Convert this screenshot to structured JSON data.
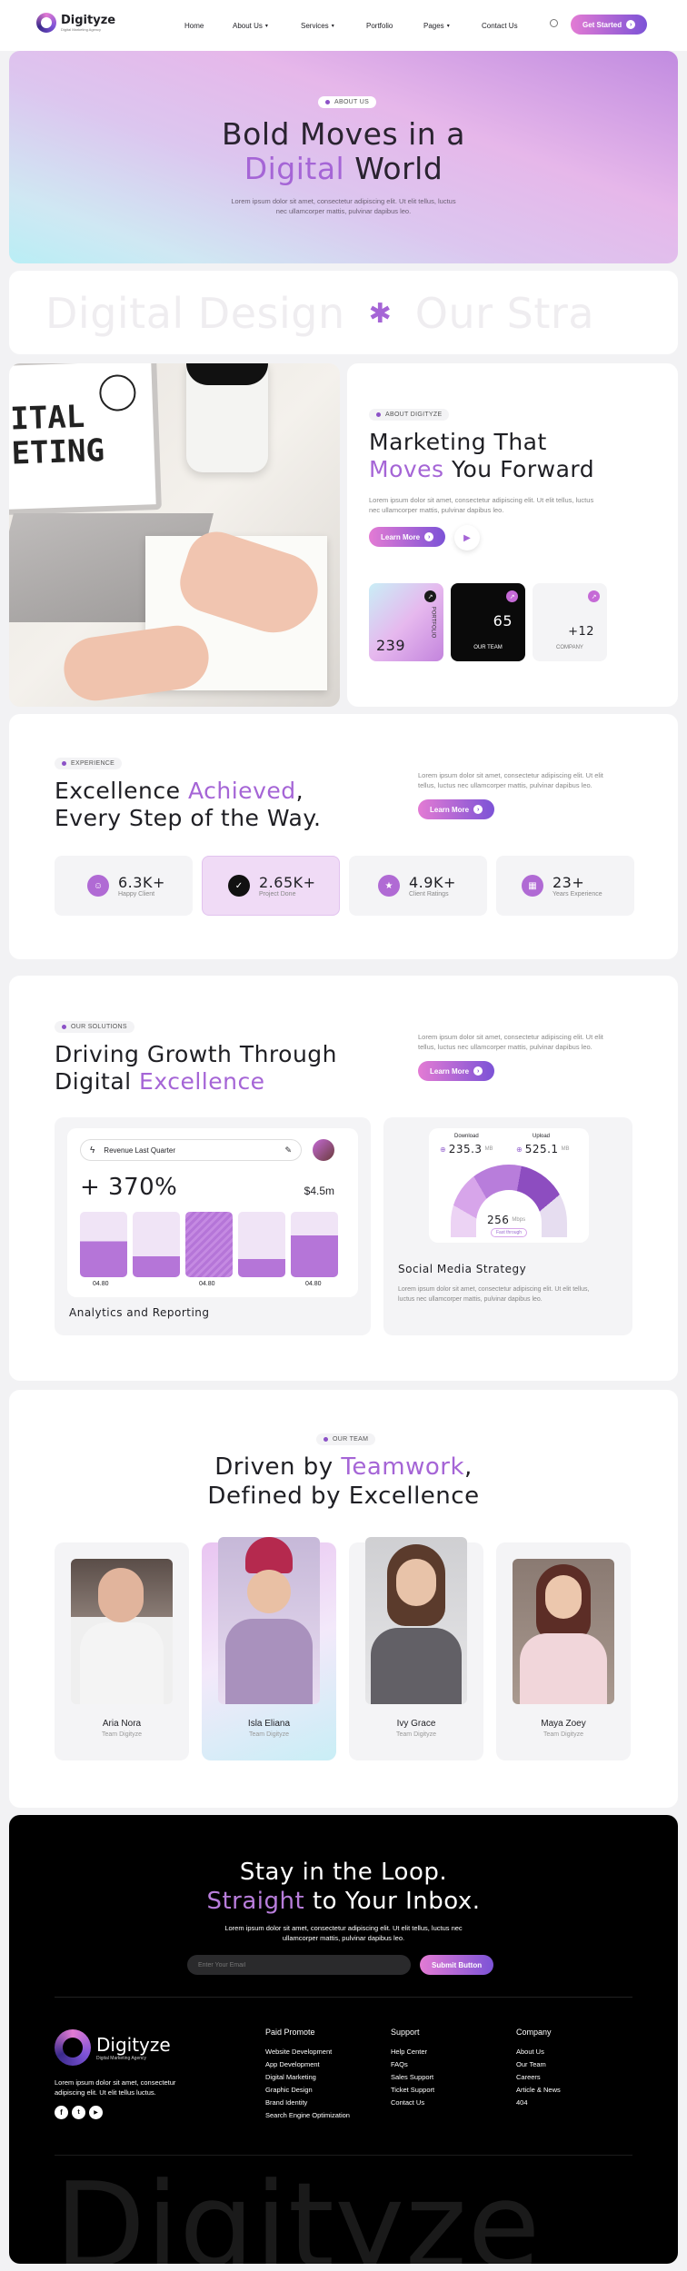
{
  "nav": {
    "brand": "Digityze",
    "tagline": "Digital Marketing Agency",
    "items": [
      "Home",
      "About Us",
      "Services",
      "Portfolio",
      "Pages",
      "Contact Us"
    ],
    "cta": "Get Started"
  },
  "hero": {
    "badge": "ABOUT US",
    "line1": "Bold Moves in a",
    "accent": "Digital",
    "line2b": "World",
    "desc1": "Lorem ipsum dolor sit amet, consectetur adipiscing elit. Ut elit tellus, luctus",
    "desc2": "nec ullamcorper mattis, pulvinar dapibus leo."
  },
  "marquee": {
    "text1": "Digital Design",
    "text2": "Our Stra"
  },
  "about": {
    "badge": "ABOUT DIGITYZE",
    "title1": "Marketing That",
    "accent": "Moves",
    "title2b": "You Forward",
    "desc1": "Lorem ipsum dolor sit amet, consectetur adipiscing elit. Ut elit tellus, luctus",
    "desc2": "nec ullamcorper mattis, pulvinar dapibus leo.",
    "cta": "Learn More",
    "stat1_value": "239",
    "stat1_label": "PORTFOLIO",
    "stat2_value": "65",
    "stat2_label": "OUR TEAM",
    "stat3_value": "+12",
    "stat3_label": "COMPANY"
  },
  "experience": {
    "badge": "EXPERIENCE",
    "title1": "Excellence",
    "accent": "Achieved",
    "title1b": ",",
    "title2": "Every Step of the Way.",
    "desc1": "Lorem ipsum dolor sit amet, consectetur adipiscing elit. Ut elit",
    "desc2": "tellus, luctus nec ullamcorper mattis, pulvinar dapibus leo.",
    "cta": "Learn More",
    "stats": [
      {
        "value": "6.3K+",
        "label": "Happy Client"
      },
      {
        "value": "2.65K+",
        "label": "Project Done"
      },
      {
        "value": "4.9K+",
        "label": "Client Ratings"
      },
      {
        "value": "23+",
        "label": "Years Experience"
      }
    ]
  },
  "solutions": {
    "badge": "OUR SOLUTIONS",
    "title1": "Driving Growth Through",
    "title2a": "Digital",
    "accent": "Excellence",
    "desc1": "Lorem ipsum dolor sit amet, consectetur adipiscing elit. Ut elit",
    "desc2": "tellus, luctus nec ullamcorper mattis, pulvinar dapibus leo.",
    "cta": "Learn More",
    "revenue_label": "Revenue Last Quarter",
    "percent": "+ 370%",
    "amount": "$4.5m",
    "bar_labels": [
      "04.80",
      "04.80",
      "04.80"
    ],
    "analytics_title": "Analytics and Reporting",
    "download_label": "Download",
    "download_value": "235.3",
    "upload_label": "Upload",
    "upload_value": "525.1",
    "unit": "MB",
    "gauge_value": "256",
    "gauge_unit": "Mbps",
    "gauge_btn": "Fast through",
    "social_title": "Social Media Strategy",
    "social_desc1": "Lorem ipsum dolor sit amet, consectetur adipiscing elit. Ut elit tellus,",
    "social_desc2": "luctus nec ullamcorper mattis, pulvinar dapibus leo."
  },
  "team": {
    "badge": "OUR TEAM",
    "title1a": "Driven by",
    "accent": "Teamwork",
    "title1b": ",",
    "title2": "Defined by Excellence",
    "members": [
      {
        "name": "Aria Nora",
        "role": "Team Digityze"
      },
      {
        "name": "Isla Eliana",
        "role": "Team Digityze"
      },
      {
        "name": "Ivy Grace",
        "role": "Team Digityze"
      },
      {
        "name": "Maya Zoey",
        "role": "Team Digityze"
      }
    ]
  },
  "newsletter": {
    "title1": "Stay in the Loop.",
    "accent": "Straight",
    "title2b": "to Your Inbox.",
    "desc1": "Lorem ipsum dolor sit amet, consectetur adipiscing elit. Ut elit tellus, luctus nec",
    "desc2": "ullamcorper mattis, pulvinar dapibus leo.",
    "placeholder": "Enter Your Email",
    "submit": "Submit Button"
  },
  "footer": {
    "brand": "Digityze",
    "tagline": "Digital Marketing Agency",
    "desc1": "Lorem ipsum dolor sit amet, consectetur",
    "desc2": "adipiscing elit. Ut elit tellus luctus.",
    "col1_title": "Paid Promote",
    "col1": [
      "Website Development",
      "App Development",
      "Digital Marketing",
      "Graphic Design",
      "Brand Identity",
      "Search Engine Optimization"
    ],
    "col2_title": "Support",
    "col2": [
      "Help Center",
      "FAQs",
      "Sales Support",
      "Ticket Support",
      "Contact Us"
    ],
    "col3_title": "Company",
    "col3": [
      "About Us",
      "Our Team",
      "Careers",
      "Article & News",
      "404"
    ],
    "big": "Digityze"
  }
}
